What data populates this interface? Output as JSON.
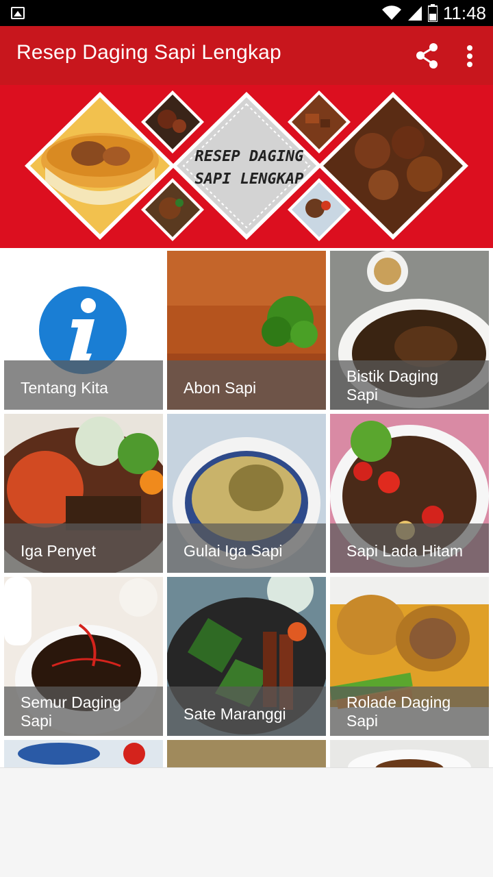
{
  "status_bar": {
    "time": "11:48",
    "icons": [
      "image-icon",
      "wifi-icon",
      "signal-icon",
      "battery-icon"
    ]
  },
  "app_bar": {
    "title": "Resep Daging Sapi Lengkap",
    "actions": [
      "share-icon",
      "more-vert-icon"
    ]
  },
  "banner": {
    "line1": "RESEP DAGING",
    "line2": "SAPI LENGKAP"
  },
  "theme": {
    "primary": "#c8161d",
    "banner_bg": "#dc0f1f",
    "info_blue": "#1a7ed4",
    "caption_overlay": "rgba(90,90,90,0.72)"
  },
  "menu": {
    "items": [
      {
        "label": "Tentang Kita",
        "icon": "info-icon"
      },
      {
        "label": "Abon Sapi"
      },
      {
        "label": "Bistik Daging Sapi"
      },
      {
        "label": "Iga Penyet"
      },
      {
        "label": "Gulai Iga Sapi"
      },
      {
        "label": "Sapi Lada Hitam"
      },
      {
        "label": "Semur Daging Sapi"
      },
      {
        "label": "Sate Maranggi"
      },
      {
        "label": "Rolade Daging Sapi"
      }
    ]
  }
}
